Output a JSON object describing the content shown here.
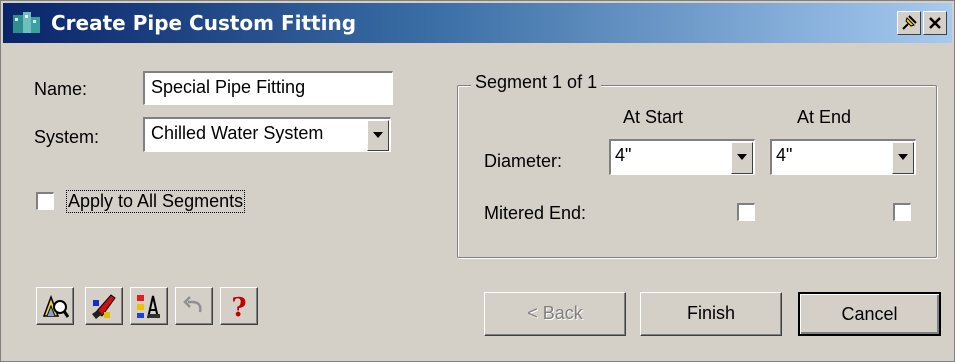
{
  "window": {
    "title": "Create Pipe Custom Fitting",
    "title_buttons": [
      "pin-icon",
      "close-icon"
    ]
  },
  "form": {
    "name_label": "Name:",
    "name_value": "Special Pipe Fitting",
    "system_label": "System:",
    "system_value": "Chilled Water System",
    "apply_all_label": "Apply to All Segments",
    "apply_all_checked": false
  },
  "segment": {
    "title": "Segment 1 of 1",
    "col_start": "At Start",
    "col_end": "At End",
    "diameter_label": "Diameter:",
    "diameter_start": "4\"",
    "diameter_end": "4\"",
    "mitered_label": "Mitered End:",
    "mitered_start": false,
    "mitered_end": false
  },
  "toolbar": {
    "icons": [
      "find-icon",
      "style-icon",
      "properties-icon",
      "undo-icon",
      "help-icon"
    ]
  },
  "buttons": {
    "back": "< Back",
    "finish": "Finish",
    "cancel": "Cancel"
  },
  "colors": {
    "face": "#d4d0c8",
    "title_start": "#0a246a",
    "title_end": "#a6caf0"
  }
}
